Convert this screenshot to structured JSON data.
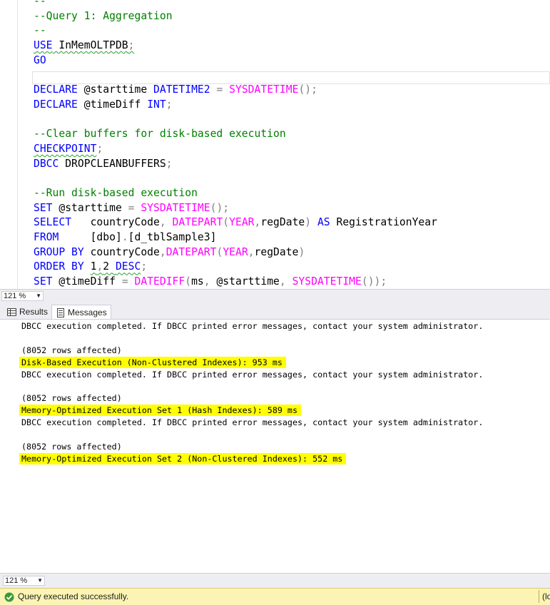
{
  "editor": {
    "lines": [
      [
        {
          "t": "--",
          "c": "cm"
        }
      ],
      [
        {
          "t": "--Query 1: Aggregation",
          "c": "cm"
        }
      ],
      [
        {
          "t": "--",
          "c": "cm"
        }
      ],
      [
        {
          "t": "USE",
          "c": "kw sq"
        },
        {
          "t": " InMemOLTPDB",
          "c": "sq"
        },
        {
          "t": ";",
          "c": "gr sq"
        }
      ],
      [
        {
          "t": "GO",
          "c": "kw"
        }
      ],
      [],
      [
        {
          "t": "DECLARE",
          "c": "kw"
        },
        {
          "t": " @starttime "
        },
        {
          "t": "DATETIME2",
          "c": "kw"
        },
        {
          "t": " "
        },
        {
          "t": "=",
          "c": "gr"
        },
        {
          "t": " "
        },
        {
          "t": "SYSDATETIME",
          "c": "fn"
        },
        {
          "t": "();",
          "c": "gr"
        }
      ],
      [
        {
          "t": "DECLARE",
          "c": "kw"
        },
        {
          "t": " @timeDiff "
        },
        {
          "t": "INT",
          "c": "kw"
        },
        {
          "t": ";",
          "c": "gr"
        }
      ],
      [],
      [
        {
          "t": "--Clear buffers for disk-based execution",
          "c": "cm"
        }
      ],
      [
        {
          "t": "CHECKPOINT",
          "c": "kw sq"
        },
        {
          "t": ";",
          "c": "gr"
        }
      ],
      [
        {
          "t": "DBCC",
          "c": "kw"
        },
        {
          "t": " DROPCLEANBUFFERS"
        },
        {
          "t": ";",
          "c": "gr"
        }
      ],
      [],
      [
        {
          "t": "--Run disk-based execution",
          "c": "cm"
        }
      ],
      [
        {
          "t": "SET",
          "c": "kw"
        },
        {
          "t": " @starttime "
        },
        {
          "t": "=",
          "c": "gr"
        },
        {
          "t": " "
        },
        {
          "t": "SYSDATETIME",
          "c": "fn"
        },
        {
          "t": "();",
          "c": "gr"
        }
      ],
      [
        {
          "t": "SELECT",
          "c": "kw"
        },
        {
          "t": "   countryCode"
        },
        {
          "t": ",",
          "c": "gr"
        },
        {
          "t": " "
        },
        {
          "t": "DATEPART",
          "c": "fn"
        },
        {
          "t": "(",
          "c": "gr"
        },
        {
          "t": "YEAR",
          "c": "fn"
        },
        {
          "t": ",",
          "c": "gr"
        },
        {
          "t": "regDate"
        },
        {
          "t": ")",
          "c": "gr"
        },
        {
          "t": " "
        },
        {
          "t": "AS",
          "c": "kw"
        },
        {
          "t": " RegistrationYear"
        }
      ],
      [
        {
          "t": "FROM",
          "c": "kw"
        },
        {
          "t": "     [dbo]"
        },
        {
          "t": ".",
          "c": "gr"
        },
        {
          "t": "[d_tblSample3]"
        }
      ],
      [
        {
          "t": "GROUP BY",
          "c": "kw"
        },
        {
          "t": " countryCode"
        },
        {
          "t": ",",
          "c": "gr"
        },
        {
          "t": "DATEPART",
          "c": "fn"
        },
        {
          "t": "(",
          "c": "gr"
        },
        {
          "t": "YEAR",
          "c": "fn"
        },
        {
          "t": ",",
          "c": "gr"
        },
        {
          "t": "regDate"
        },
        {
          "t": ")",
          "c": "gr"
        }
      ],
      [
        {
          "t": "ORDER BY",
          "c": "kw"
        },
        {
          "t": " "
        },
        {
          "t": "1",
          "c": "sq"
        },
        {
          "t": ",",
          "c": "gr sq"
        },
        {
          "t": "2 ",
          "c": "sq"
        },
        {
          "t": "DESC",
          "c": "kw sq"
        },
        {
          "t": ";",
          "c": "gr"
        }
      ],
      [
        {
          "t": "SET",
          "c": "kw"
        },
        {
          "t": " @timeDiff "
        },
        {
          "t": "=",
          "c": "gr"
        },
        {
          "t": " "
        },
        {
          "t": "DATEDIFF",
          "c": "fn"
        },
        {
          "t": "(",
          "c": "gr"
        },
        {
          "t": "ms"
        },
        {
          "t": ",",
          "c": "gr"
        },
        {
          "t": " @starttime"
        },
        {
          "t": ",",
          "c": "gr"
        },
        {
          "t": " "
        },
        {
          "t": "SYSDATETIME",
          "c": "fn"
        },
        {
          "t": "());",
          "c": "gr"
        }
      ]
    ]
  },
  "zoom_top": "121 %",
  "zoom_bottom": "121 %",
  "tabs": {
    "results": "Results",
    "messages": "Messages"
  },
  "messages": [
    {
      "text": "DBCC execution completed. If DBCC printed error messages, contact your system administrator.",
      "hl": false
    },
    {
      "text": "",
      "hl": false
    },
    {
      "text": "(8052 rows affected)",
      "hl": false
    },
    {
      "text": "Disk-Based Execution (Non-Clustered Indexes): 953 ms",
      "hl": true
    },
    {
      "text": "DBCC execution completed. If DBCC printed error messages, contact your system administrator.",
      "hl": false
    },
    {
      "text": "",
      "hl": false
    },
    {
      "text": "(8052 rows affected)",
      "hl": false
    },
    {
      "text": "Memory-Optimized Execution Set 1 (Hash Indexes): 589 ms",
      "hl": true
    },
    {
      "text": "DBCC execution completed. If DBCC printed error messages, contact your system administrator.",
      "hl": false
    },
    {
      "text": "",
      "hl": false
    },
    {
      "text": "(8052 rows affected)",
      "hl": false
    },
    {
      "text": "Memory-Optimized Execution Set 2 (Non-Clustered Indexes): 552 ms",
      "hl": true
    }
  ],
  "status": {
    "text": "Query executed successfully.",
    "right": "(lo"
  },
  "colors": {
    "keyword": "#0000ff",
    "function": "#ff00ff",
    "comment": "#008000",
    "highlight": "#ffff00",
    "status_bg": "#fcf4b4"
  }
}
